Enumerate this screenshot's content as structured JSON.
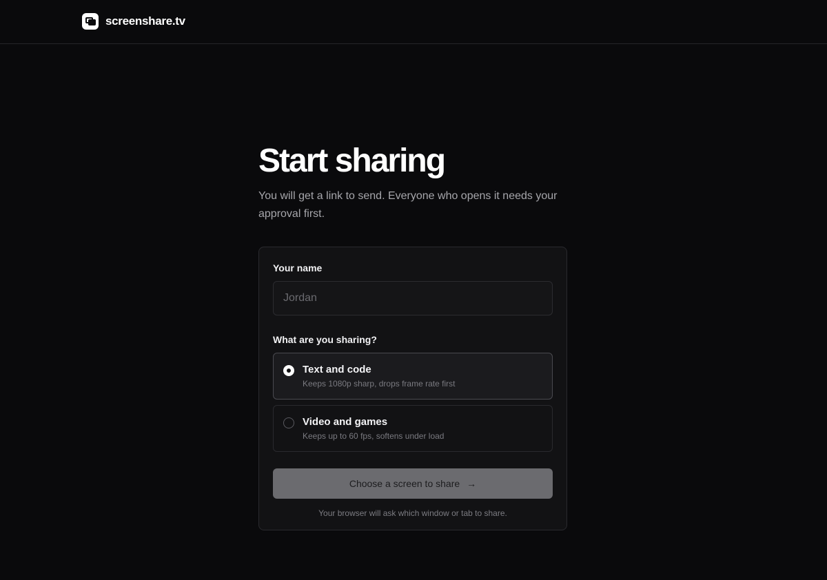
{
  "header": {
    "brand_name": "screenshare.tv",
    "logo_icon": "screens-logo-icon"
  },
  "main": {
    "title": "Start sharing",
    "subtitle": "You will get a link to send. Everyone who opens it needs your approval first."
  },
  "form": {
    "name_label": "Your name",
    "name_placeholder": "Jordan",
    "name_value": "",
    "sharing_label": "What are you sharing?",
    "options": [
      {
        "title": "Text and code",
        "description": "Keeps 1080p sharp, drops frame rate first",
        "selected": true
      },
      {
        "title": "Video and games",
        "description": "Keeps up to 60 fps, softens under load",
        "selected": false
      }
    ],
    "cta_label": "Choose a screen to share",
    "cta_icon": "arrow-right-icon",
    "hint": "Your browser will ask which window or tab to share."
  },
  "colors": {
    "background": "#0a0a0c",
    "card": "#121214",
    "border": "#2a2a2e",
    "cta_disabled": "#6b6b6f"
  }
}
